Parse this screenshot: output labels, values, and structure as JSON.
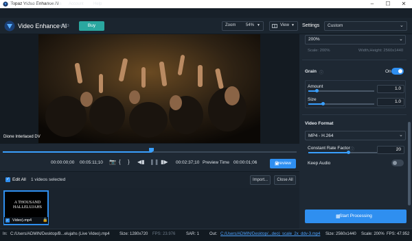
{
  "window": {
    "title": "Topaz Video Enhance AI",
    "minimize": "–",
    "maximize": "☐",
    "close": "✕"
  },
  "menu": [
    "File",
    "Preview",
    "Process",
    "Account",
    "Help"
  ],
  "header": {
    "app_name": "Video Enhance AI",
    "version": "v2.6.3",
    "buy_label": "Buy",
    "zoom_label": "Zoom",
    "zoom_value": "54%",
    "view_label": "View",
    "settings_label": "Settings",
    "settings_value": "Custom"
  },
  "video": {
    "caption": "Dione Interlaced DV"
  },
  "timeline": {
    "start": "00:00:00;00",
    "end": "00:05:11;10",
    "current": "00:02:37;10",
    "preview_time_label": "Preview Time",
    "preview_time": "00:00:01;06",
    "preview_label": "Preview",
    "progress": 0.5
  },
  "filelist": {
    "edit_all_label": "Edit All",
    "selected_text": "1 videos selected",
    "import_label": "Import...",
    "close_all_label": "Close All",
    "thumb_name": "Video).mp4",
    "thumb_title_1": "A THOUSAND",
    "thumb_title_2": "HALLELUJAHS"
  },
  "panel": {
    "scale_value": "200%",
    "scale_info_left": "Scale: 200%",
    "scale_info_right": "Width,Height: 2560x1440",
    "grain_label": "Grain",
    "grain_toggle": "On",
    "amount_label": "Amount",
    "amount_value": "1.0",
    "size_label": "Size",
    "size_value": "1.0",
    "video_format_label": "Video Format",
    "format_value": "MP4 - H.264",
    "crf_label": "Constant Rate Factor",
    "crf_value": "20",
    "keep_audio_label": "Keep Audio",
    "start_label": "Start Processing"
  },
  "status": {
    "in_label": "In:",
    "in_path": "C:/Users/ADMIN/Desktop/B...elujahs (Live Video).mp4",
    "size_in": "Size: 1280x720",
    "fps_in": "FPS: 23.976",
    "sar": "SAR: 1",
    "out_label": "Out:",
    "out_path": "C:/Users/ADMIN/Desktop/...deo)_scale_2x_ddv-3.mp4",
    "size_out": "Size: 2560x1440",
    "scale": "Scale: 200%",
    "fps_out": "FPS: 47.952"
  },
  "colors": {
    "accent": "#2f8ff0",
    "buy": "#2aa7a0",
    "bg": "#1e2833"
  }
}
